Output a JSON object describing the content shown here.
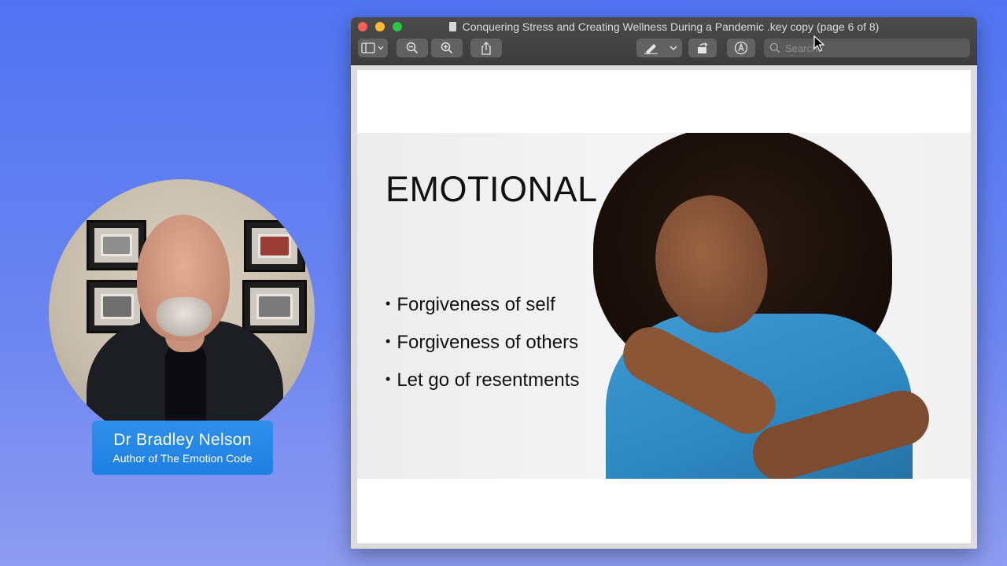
{
  "presenter": {
    "name": "Dr Bradley Nelson",
    "role": "Author of The Emotion Code"
  },
  "window": {
    "title": "Conquering Stress and Creating Wellness During a Pandemic .key copy (page 6 of 8)",
    "search_placeholder": "Search"
  },
  "toolbar": {
    "items": [
      "sidebar-toggle",
      "zoom-out",
      "zoom-in",
      "share",
      "markup-pen",
      "markup-dropdown",
      "rotate",
      "annotate"
    ]
  },
  "slide": {
    "heading": "EMOTIONAL",
    "bullets": [
      "Forgiveness of self",
      "Forgiveness of others",
      "Let go of resentments"
    ]
  },
  "colors": {
    "background": "#5b7cf2",
    "name_plate": "#2287e6",
    "shirt_accent": "#2c86c0"
  }
}
